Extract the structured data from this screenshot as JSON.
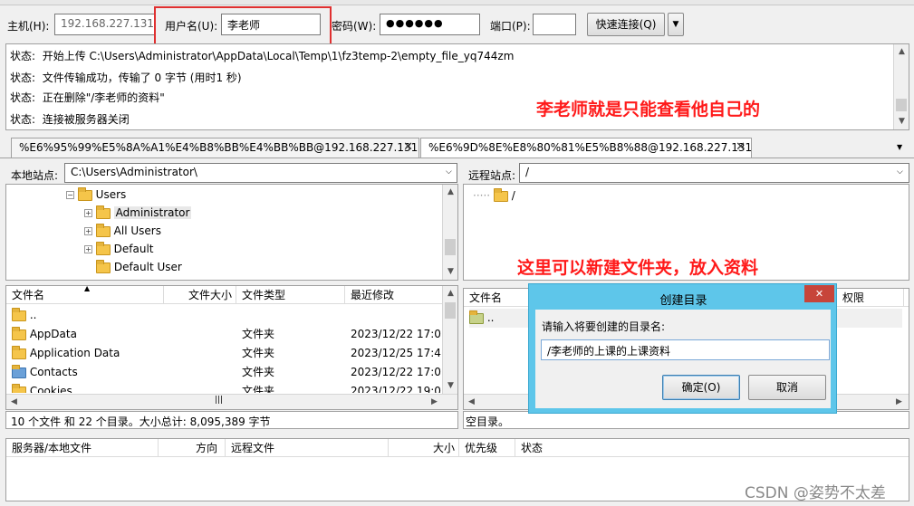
{
  "quickconnect": {
    "host_label": "主机(H):",
    "host_value": "192.168.227.131",
    "user_label": "用户名(U):",
    "user_value": "李老师",
    "password_label": "密码(W):",
    "password_value": "●●●●●●",
    "port_label": "端口(P):",
    "port_value": "",
    "connect_label": "快速连接(Q)"
  },
  "log": [
    {
      "label": "状态:",
      "text": "开始上传 C:\\Users\\Administrator\\AppData\\Local\\Temp\\1\\fz3temp-2\\empty_file_yq744zm"
    },
    {
      "label": "状态:",
      "text": "文件传输成功，传输了 0 字节 (用时1 秒)"
    },
    {
      "label": "状态:",
      "text": "正在删除\"/李老师的资料\""
    },
    {
      "label": "状态:",
      "text": "连接被服务器关闭"
    }
  ],
  "annotations": {
    "top": "李老师就是只能查看他自己的",
    "middle": "这里可以新建文件夹，放入资料"
  },
  "tabs": [
    {
      "label": "%E6%95%99%E5%8A%A1%E4%B8%BB%E4%BB%BB@192.168.227.131"
    },
    {
      "label": "%E6%9D%8E%E8%80%81%E5%B8%88@192.168.227.131"
    }
  ],
  "local": {
    "site_label": "本地站点:",
    "site_path": "C:\\Users\\Administrator\\",
    "tree": [
      "Users",
      "Administrator",
      "All Users",
      "Default",
      "Default User"
    ],
    "columns": [
      "文件名",
      "文件大小",
      "文件类型",
      "最近修改"
    ],
    "files": [
      {
        "name": "..",
        "size": "",
        "type": "",
        "modified": ""
      },
      {
        "name": "AppData",
        "size": "",
        "type": "文件夹",
        "modified": "2023/12/22 17:0..."
      },
      {
        "name": "Application Data",
        "size": "",
        "type": "文件夹",
        "modified": "2023/12/25 17:4..."
      },
      {
        "name": "Contacts",
        "size": "",
        "type": "文件夹",
        "modified": "2023/12/22 17:0..."
      },
      {
        "name": "Cookies",
        "size": "",
        "type": "文件夹",
        "modified": "2023/12/22 19:0..."
      }
    ],
    "status": "10 个文件 和 22 个目录。大小总计: 8,095,389 字节"
  },
  "remote": {
    "site_label": "远程站点:",
    "site_path": "/",
    "tree": [
      "/"
    ],
    "columns": [
      "文件名",
      "权限"
    ],
    "files": [
      {
        "name": ".."
      }
    ],
    "status": "空目录。"
  },
  "dialog": {
    "title": "创建目录",
    "prompt": "请输入将要创建的目录名:",
    "value": "/李老师的上课的上课资料",
    "ok_label": "确定(O)",
    "cancel_label": "取消",
    "close_glyph": "✕"
  },
  "queue": {
    "columns": [
      "服务器/本地文件",
      "方向",
      "远程文件",
      "大小",
      "优先级",
      "状态"
    ]
  },
  "watermark": "CSDN @姿势不太差",
  "colors": {
    "annotation": "#ff1a1a",
    "dialog_border": "#5ec6ea",
    "dialog_close": "#c7453a",
    "highlight_box": "#e03030"
  }
}
